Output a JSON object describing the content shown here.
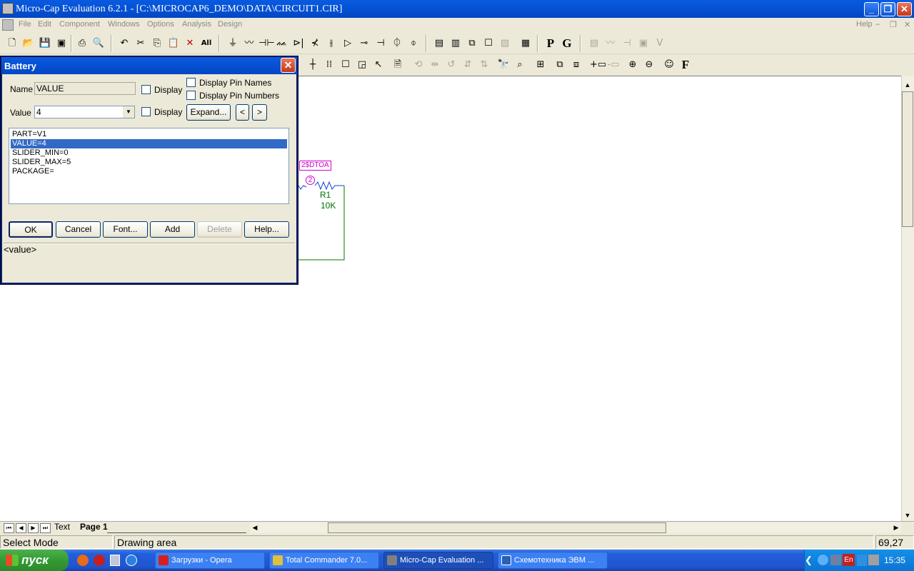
{
  "window": {
    "title": "Micro-Cap Evaluation 6.2.1 - [C:\\MICROCAP6_DEMO\\DATA\\CIRCUIT1.CIR]",
    "minimize": "_",
    "restore": "❐",
    "close": "✕"
  },
  "menu": {
    "items": [
      "File",
      "Edit",
      "Component",
      "Windows",
      "Options",
      "Analysis",
      "Design"
    ],
    "help": "Help"
  },
  "toolbar": {
    "p_label": "P",
    "g_label": "G",
    "f_label": "F"
  },
  "dialog": {
    "title": "Battery",
    "close": "✕",
    "name_label": "Name",
    "name_value": "VALUE",
    "display_label_1": "Display",
    "display_label_2": "Display",
    "display_pin_names": "Display Pin Names",
    "display_pin_numbers": "Display Pin Numbers",
    "value_label": "Value",
    "value_value": "4",
    "expand_button": "Expand...",
    "prev_button": "<",
    "next_button": ">",
    "properties": [
      "PART=V1",
      "VALUE=4",
      "SLIDER_MIN=0",
      "SLIDER_MAX=5",
      "PACKAGE="
    ],
    "selected_property": "VALUE=4",
    "buttons": {
      "ok": "OK",
      "cancel": "Cancel",
      "font": "Font...",
      "add": "Add",
      "delete": "Delete",
      "help": "Help..."
    },
    "hint": "<value>"
  },
  "schematic": {
    "net_label": "2$DTOA",
    "node_number": "2",
    "resistor_name": "R1",
    "resistor_value": "10K"
  },
  "tabs": {
    "text": "Text",
    "page1": "Page 1"
  },
  "status": {
    "mode": "Select Mode",
    "area": "Drawing area",
    "coords": "69,27"
  },
  "taskbar": {
    "start": "пуск",
    "tasks": [
      {
        "label": "Загрузки - Opera",
        "icon_color": "#d42020"
      },
      {
        "label": "Total Commander 7.0...",
        "icon_color": "#e0c040"
      },
      {
        "label": "Micro-Cap Evaluation ...",
        "icon_color": "#808080"
      },
      {
        "label": "Схемотехника ЭВМ ...",
        "icon_color": "#2b5fb8"
      }
    ],
    "lang": "En",
    "clock": "15:35"
  },
  "colors": {
    "xp_blue": "#0554d7",
    "selection": "#316ac5",
    "net_magenta": "#d000d0",
    "component_green": "#007000",
    "wire_green": "#007000"
  }
}
